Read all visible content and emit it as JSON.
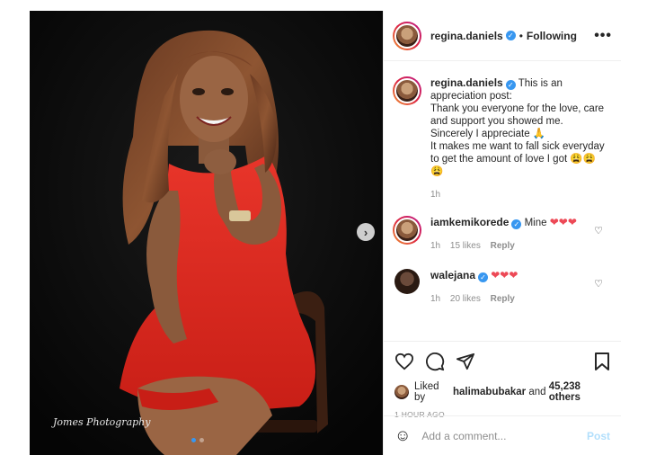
{
  "photo": {
    "watermark": "Jomes Photography"
  },
  "header": {
    "username": "regina.daniels",
    "separator": "•",
    "follow_status": "Following",
    "more": "•••"
  },
  "caption": {
    "username": "regina.daniels",
    "lines": [
      "This is an",
      "appreciation post:",
      "Thank you everyone for the love, care",
      "and support you showed me.",
      "Sincerely I appreciate 🙏",
      "It makes me want to fall sick everyday",
      "to get the amount of love I got 😩😩",
      "😩"
    ],
    "time": "1h"
  },
  "comments": [
    {
      "username": "iamkemikorede",
      "text": "Mine",
      "hearts": "❤❤❤",
      "time": "1h",
      "likes": "15 likes",
      "reply": "Reply"
    },
    {
      "username": "walejana",
      "text": "",
      "hearts": "❤❤❤",
      "time": "1h",
      "likes": "20 likes",
      "reply": "Reply"
    }
  ],
  "likes": {
    "prefix": "Liked by",
    "user": "halimabubakar",
    "middle": "and",
    "count": "45,238 others"
  },
  "age": "1 HOUR AGO",
  "add_comment": {
    "placeholder": "Add a comment...",
    "post": "Post"
  },
  "icons": {
    "next": "chevron-right-icon",
    "like": "heart-outline-icon",
    "comment": "comment-icon",
    "share": "paper-plane-icon",
    "save": "bookmark-icon",
    "emoji": "smiley-icon"
  },
  "colors": {
    "dress": "#e0281f",
    "verified": "#3897f0",
    "heart": "#ed4956",
    "post_disabled": "#b2dffc"
  }
}
